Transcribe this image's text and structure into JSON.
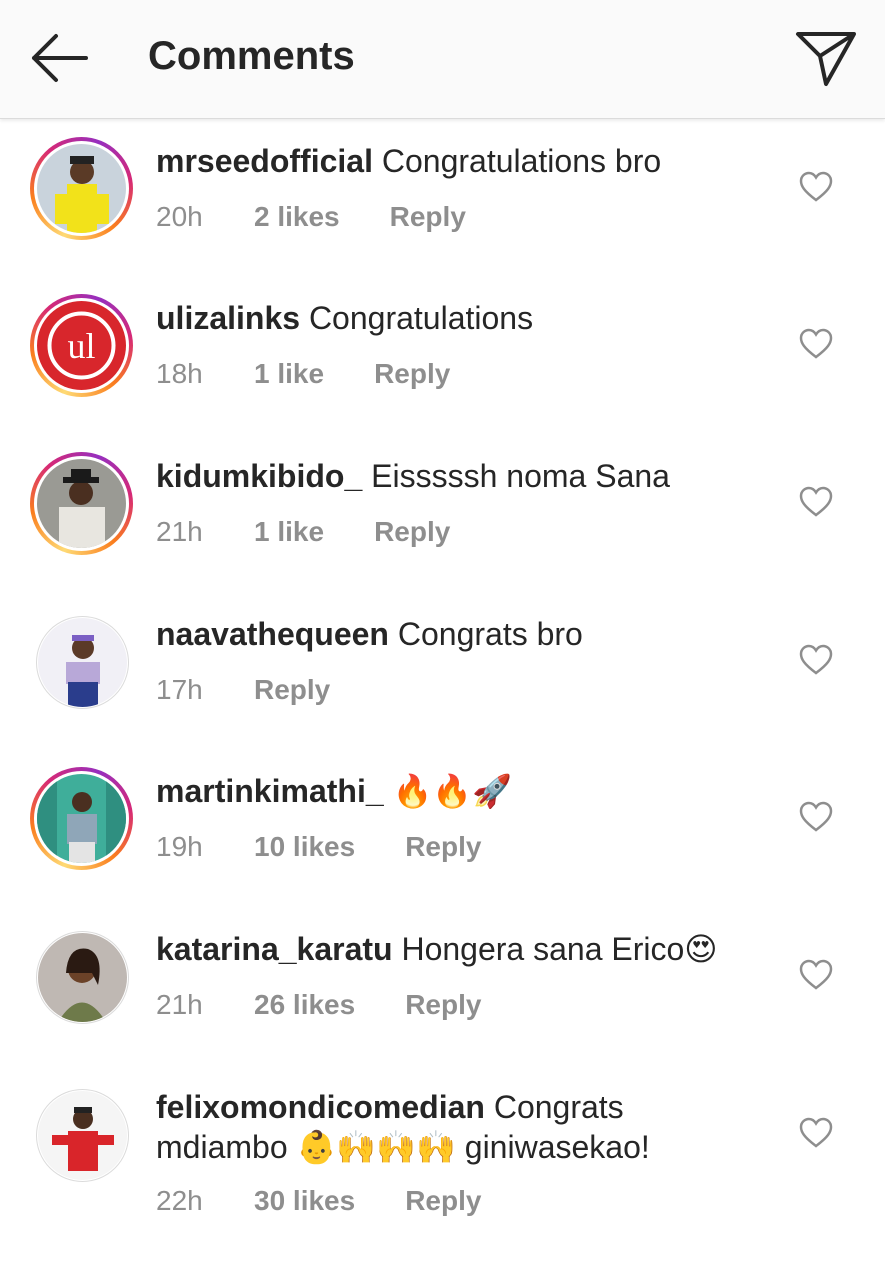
{
  "header": {
    "title": "Comments",
    "back_icon": "arrow-left-icon",
    "share_icon": "paper-plane-icon"
  },
  "colors": {
    "text": "#262626",
    "meta": "#8e8e8e",
    "divider": "#dbdbdb"
  },
  "comments": [
    {
      "username": "mrseedofficial",
      "text": "Congratulations bro",
      "time": "20h",
      "likes": "2 likes",
      "reply": "Reply",
      "story_ring": true
    },
    {
      "username": "ulizalinks",
      "text": "Congratulations",
      "time": "18h",
      "likes": "1 like",
      "reply": "Reply",
      "story_ring": true
    },
    {
      "username": "kidumkibido_",
      "text": "Eisssssh  noma Sana",
      "time": "21h",
      "likes": "1 like",
      "reply": "Reply",
      "story_ring": true
    },
    {
      "username": "naavathequeen",
      "text": "Congrats bro",
      "time": "17h",
      "likes": "",
      "reply": "Reply",
      "story_ring": false
    },
    {
      "username": "martinkimathi_",
      "text": "🔥🔥🚀",
      "time": "19h",
      "likes": "10 likes",
      "reply": "Reply",
      "story_ring": true
    },
    {
      "username": "katarina_karatu",
      "text": "Hongera  sana Erico😍",
      "time": "21h",
      "likes": "26 likes",
      "reply": "Reply",
      "story_ring": false
    },
    {
      "username": "felixomondicomedian",
      "text_line1": "Congrats",
      "text_line2_a": "mdiambo",
      "text_line2_b": "giniwasekao!",
      "text_emojis": "👶🙌🙌🙌",
      "time": "22h",
      "likes": "30 likes",
      "reply": "Reply",
      "story_ring": false
    }
  ]
}
